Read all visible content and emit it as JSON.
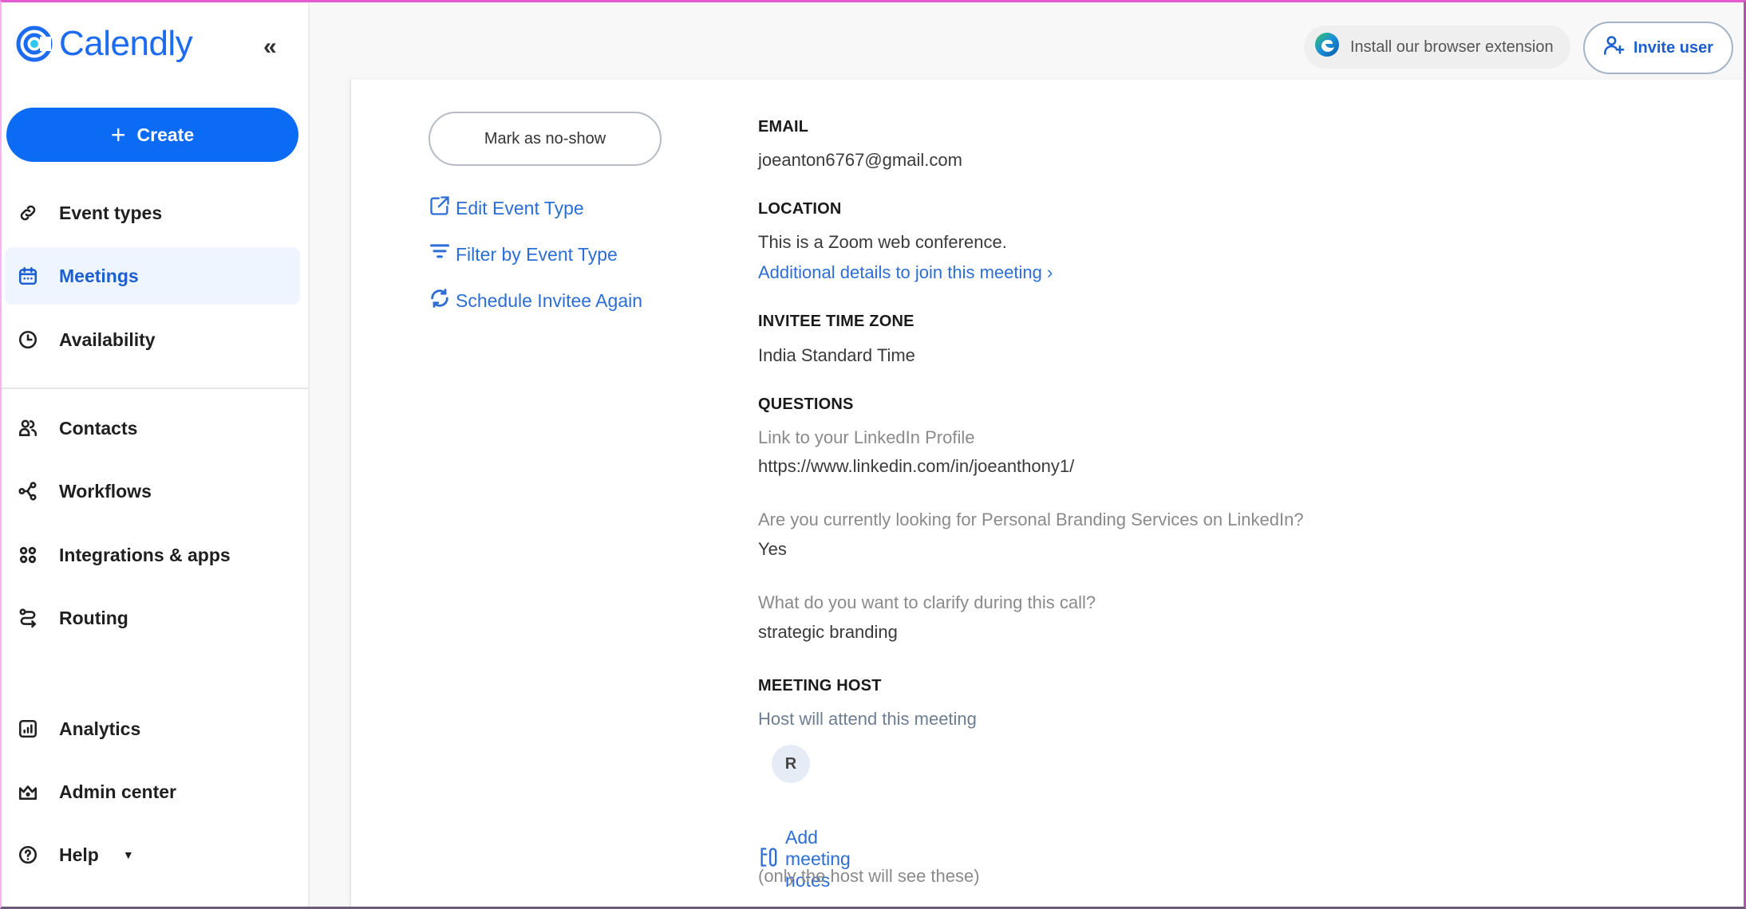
{
  "app": {
    "brand": "Calendly",
    "brand_color": "#0b6bf5"
  },
  "sidebar": {
    "collapse_icon": "double-chevron-left-icon",
    "create_label": "Create",
    "items": [
      {
        "label": "Event types",
        "icon": "link-icon",
        "active": false
      },
      {
        "label": "Meetings",
        "icon": "calendar-icon",
        "active": true
      },
      {
        "label": "Availability",
        "icon": "clock-icon",
        "active": false
      },
      {
        "label": "Contacts",
        "icon": "contacts-icon",
        "active": false
      },
      {
        "label": "Workflows",
        "icon": "workflow-icon",
        "active": false
      },
      {
        "label": "Integrations & apps",
        "icon": "apps-grid-icon",
        "active": false
      },
      {
        "label": "Routing",
        "icon": "routing-icon",
        "active": false
      },
      {
        "label": "Analytics",
        "icon": "analytics-icon",
        "active": false
      },
      {
        "label": "Admin center",
        "icon": "crown-icon",
        "active": false
      },
      {
        "label": "Help",
        "icon": "help-icon",
        "active": false,
        "has_dropdown": true
      }
    ]
  },
  "topbar": {
    "extension_label": "Install our browser extension",
    "invite_label": "Invite user"
  },
  "actions": {
    "no_show_label": "Mark as no-show",
    "edit_event_type": "Edit Event Type",
    "filter_by_event_type": "Filter by Event Type",
    "schedule_again": "Schedule Invitee Again"
  },
  "details": {
    "email": {
      "label": "EMAIL",
      "value": "joeanton6767@gmail.com"
    },
    "location": {
      "label": "LOCATION",
      "value": "This is a Zoom web conference.",
      "link": "Additional details to join this meeting"
    },
    "timezone": {
      "label": "INVITEE TIME ZONE",
      "value": "India Standard Time"
    },
    "questions": {
      "label": "QUESTIONS",
      "items": [
        {
          "question": "Link to your LinkedIn Profile",
          "answer": "https://www.linkedin.com/in/joeanthony1/"
        },
        {
          "question": "Are you currently looking for Personal Branding Services on LinkedIn?",
          "answer": "Yes"
        },
        {
          "question": "What do you want to clarify during this call?",
          "answer": "strategic branding"
        }
      ]
    },
    "host": {
      "label": "MEETING HOST",
      "note": "Host will attend this meeting",
      "avatar_initial": "R"
    },
    "notes": {
      "link": "Add meeting notes",
      "hint": "(only the host will see these)"
    }
  }
}
